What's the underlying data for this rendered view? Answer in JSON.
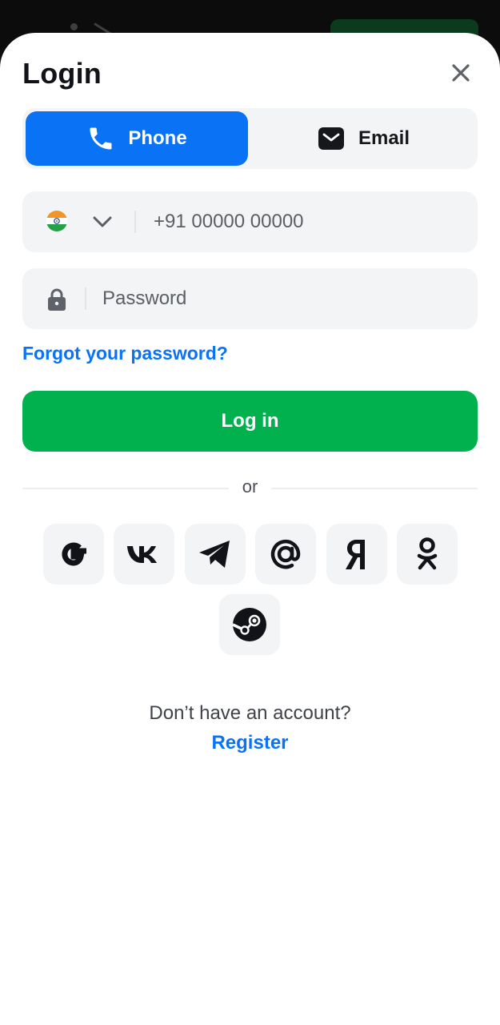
{
  "dialog": {
    "title": "Login",
    "close_icon": "close-icon"
  },
  "tabs": [
    {
      "label": "Phone",
      "icon": "phone-icon",
      "active": true
    },
    {
      "label": "Email",
      "icon": "mail-icon",
      "active": false
    }
  ],
  "phone_field": {
    "country_flag": "india-flag-icon",
    "placeholder": "+91 00000 00000",
    "value": ""
  },
  "password_field": {
    "placeholder": "Password",
    "value": ""
  },
  "forgot_password": "Forgot your password?",
  "login_button": "Log in",
  "separator": "or",
  "social_logins": [
    {
      "name": "google",
      "icon": "google-icon"
    },
    {
      "name": "vk",
      "icon": "vk-icon"
    },
    {
      "name": "telegram",
      "icon": "telegram-icon"
    },
    {
      "name": "mail",
      "icon": "at-sign-icon"
    },
    {
      "name": "yandex",
      "icon": "yandex-icon"
    },
    {
      "name": "odnoklassniki",
      "icon": "ok-icon"
    },
    {
      "name": "steam",
      "icon": "steam-icon"
    }
  ],
  "footer": {
    "prompt": "Don’t have an account?",
    "register_link": "Register"
  },
  "colors": {
    "accent_blue": "#0a72f5",
    "login_green": "#00b14e",
    "field_bg": "#f3f4f5"
  }
}
